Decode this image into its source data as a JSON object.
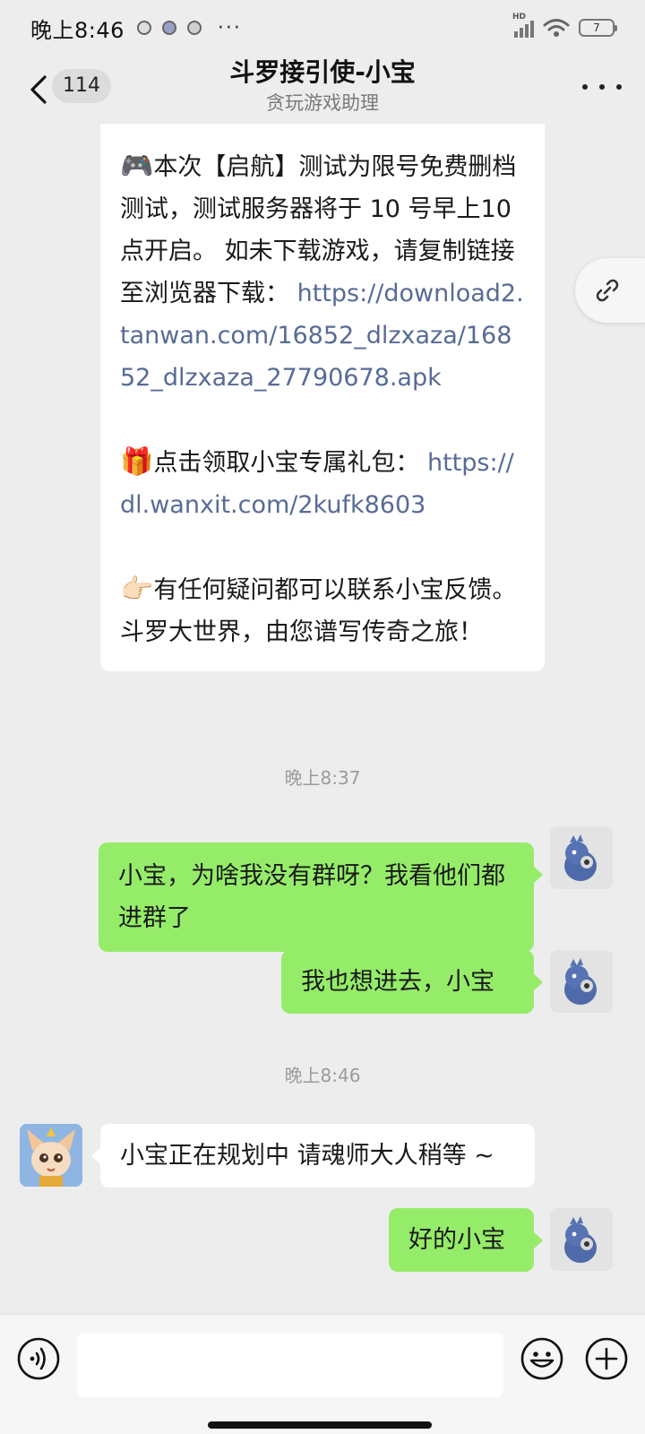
{
  "status_bar": {
    "time": "晚上8:46",
    "dots": "···",
    "battery": "7",
    "network": "HD"
  },
  "nav": {
    "unread_count": "114",
    "title": "斗罗接引使-小宝",
    "subtitle": "贪玩游戏助理"
  },
  "messages": {
    "announcement": {
      "p1_emoji": "🎮",
      "p1_text": "本次【启航】测试为限号免费删档测试，测试服务器将于 10 号早上10 点开启。 如未下载游戏，请复制链接至浏览器下载：",
      "p1_link": "https://download2.tanwan.com/16852_dlzxaza/16852_dlzxaza_27790678.apk",
      "p2_emoji": "🎁",
      "p2_text": "点击领取小宝专属礼包：",
      "p2_link": "https://dl.wanxit.com/2kufk8603",
      "p3_emoji": "👉🏻",
      "p3_text": "有任何疑问都可以联系小宝反馈。 斗罗大世界，由您谱写传奇之旅！"
    },
    "time1": "晚上8:37",
    "out1": "小宝，为啥我没有群呀？我看他们都进群了",
    "out2": "我也想进去，小宝",
    "time2": "晚上8:46",
    "in1": "小宝正在规划中 请魂师大人稍等 ~",
    "out3": "好的小宝"
  },
  "input": {
    "placeholder": ""
  },
  "colors": {
    "background": "#ededed",
    "outgoing_bubble": "#95ec69",
    "incoming_bubble": "#ffffff",
    "link": "#576b95"
  },
  "icons": [
    "back-icon",
    "more-icon",
    "link-icon",
    "voice-icon",
    "emoji-icon",
    "plus-icon"
  ]
}
